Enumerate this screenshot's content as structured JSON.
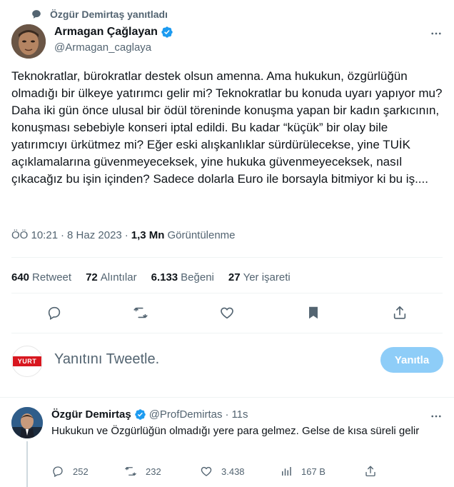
{
  "context": {
    "text": "Özgür Demirtaş yanıtladı"
  },
  "tweet": {
    "author_name": "Armagan Çağlayan",
    "author_handle": "@Armagan_caglaya",
    "text": "Teknokratlar, bürokratlar destek olsun amenna. Ama hukukun, özgürlüğün olmadığı bir ülkeye yatırımcı gelir mi? Teknokratlar bu konuda uyarı yapıyor mu? Daha iki gün önce ulusal bir ödül töreninde konuşma yapan bir kadın şarkıcının, konuşması sebebiyle konseri iptal edildi. Bu kadar “küçük” bir olay bile yatırımcıyı ürkütmez mi? Eğer eski alışkanlıklar sürdürülecekse, yine TUİK açıklamalarına güvenmeyeceksek, yine hukuka güvenmeyeceksek, nasıl çıkacağız bu işin içinden? Sadece dolarla Euro ile borsayla bitmiyor ki bu iş....",
    "time": "ÖÖ 10:21",
    "date": "8 Haz 2023",
    "dot": "·",
    "views_count": "1,3 Mn",
    "views_label": "Görüntülenme"
  },
  "stats": {
    "retweets_count": "640",
    "retweets_label": "Retweet",
    "quotes_count": "72",
    "quotes_label": "Alıntılar",
    "likes_count": "6.133",
    "likes_label": "Beğeni",
    "bookmarks_count": "27",
    "bookmarks_label": "Yer işareti"
  },
  "composer": {
    "avatar_text": "YURT",
    "placeholder": "Yanıtını Tweetle.",
    "button_label": "Yanıtla"
  },
  "reply": {
    "author_name": "Özgür Demirtaş",
    "author_handle": "@ProfDemirtas",
    "dot": "·",
    "time": "11s",
    "text": "Hukukun ve Özgürlüğün olmadığı yere para gelmez. Gelse de kısa süreli gelir",
    "replies": "252",
    "retweets": "232",
    "likes": "3.438",
    "views": "167 B"
  },
  "colors": {
    "verified": "#1d9bf0",
    "muted": "#536471",
    "text": "#0f1419",
    "reply_button": "#8ecdf8",
    "yurt_red": "#d8171f"
  }
}
